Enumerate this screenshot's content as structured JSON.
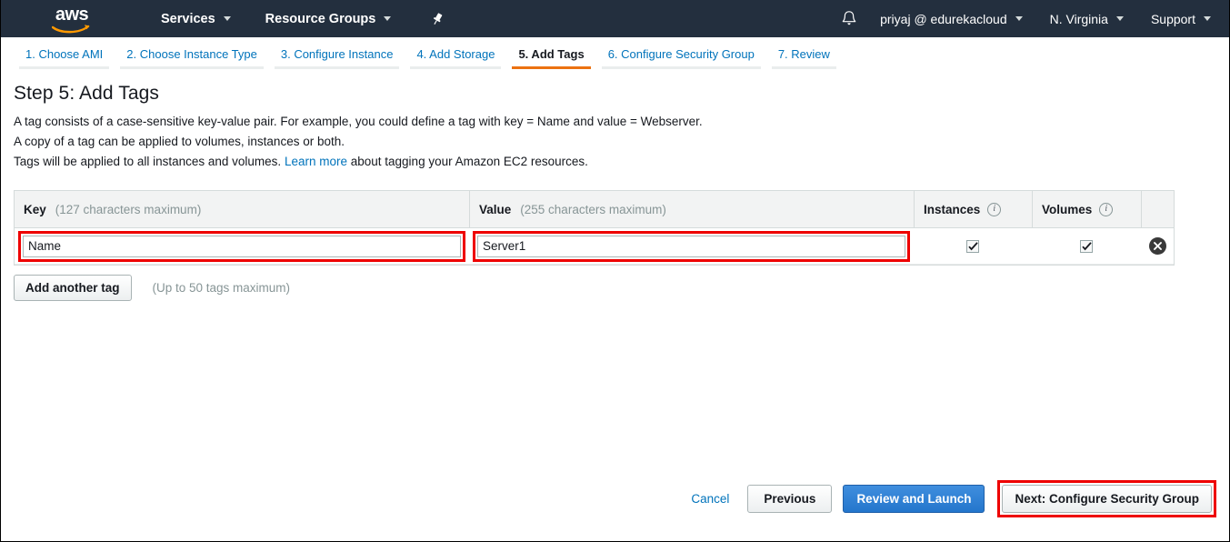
{
  "topnav": {
    "logo_alt": "aws",
    "services_label": "Services",
    "resource_groups_label": "Resource Groups",
    "pin_icon": "pin-icon",
    "bell_icon": "bell-icon",
    "user_label": "priyaj @ edurekacloud",
    "region_label": "N. Virginia",
    "support_label": "Support",
    "bg_color": "#232f3e",
    "accent_color": "#ec7211"
  },
  "steps": [
    {
      "label": "1. Choose AMI",
      "active": false
    },
    {
      "label": "2. Choose Instance Type",
      "active": false
    },
    {
      "label": "3. Configure Instance",
      "active": false
    },
    {
      "label": "4. Add Storage",
      "active": false
    },
    {
      "label": "5. Add Tags",
      "active": true
    },
    {
      "label": "6. Configure Security Group",
      "active": false
    },
    {
      "label": "7. Review",
      "active": false
    }
  ],
  "main": {
    "title": "Step 5: Add Tags",
    "description_line1": "A tag consists of a case-sensitive key-value pair. For example, you could define a tag with key = Name and value = Webserver.",
    "description_line2": "A copy of a tag can be applied to volumes, instances or both.",
    "description_line3_before": "Tags will be applied to all instances and volumes.",
    "learn_more_label": "Learn more",
    "description_line3_after": "about tagging your Amazon EC2 resources."
  },
  "table": {
    "key_header": "Key",
    "key_hint": "(127 characters maximum)",
    "value_header": "Value",
    "value_hint": "(255 characters maximum)",
    "instances_header": "Instances",
    "volumes_header": "Volumes",
    "rows": [
      {
        "key_value": "Name",
        "key_placeholder": "",
        "value_value": "Server1",
        "value_placeholder": "",
        "instances_checked": true,
        "volumes_checked": true,
        "remove_icon": "close-circle-icon"
      }
    ]
  },
  "actions": {
    "add_tag_label": "Add another tag",
    "add_tag_hint": "(Up to 50 tags maximum)"
  },
  "footer": {
    "cancel_label": "Cancel",
    "previous_label": "Previous",
    "review_label": "Review and Launch",
    "next_label": "Next: Configure Security Group",
    "primary_color": "#2476cc",
    "highlight_color": "#ee0000"
  }
}
